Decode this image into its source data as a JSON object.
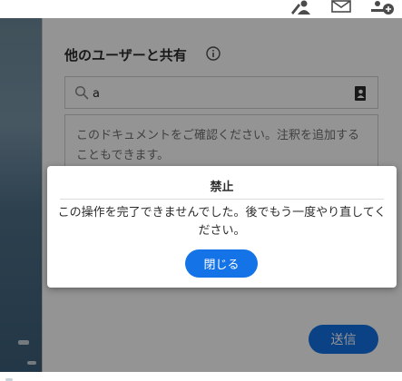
{
  "toolbar": {
    "icons": [
      "person-edit-icon",
      "mail-icon",
      "add-user-icon"
    ]
  },
  "share_panel": {
    "title": "他のユーザーと共有",
    "search": {
      "value": "a"
    },
    "message": "このドキュメントをご確認ください。注釈を追加することもできます。",
    "send_label": "送信"
  },
  "dialog": {
    "title": "禁止",
    "message": "この操作を完了できませんでした。後でもう一度やり直してください。",
    "close_label": "閉じる"
  },
  "colors": {
    "accent": "#1473e6",
    "overlay": "rgba(0,0,0,0.42)"
  }
}
